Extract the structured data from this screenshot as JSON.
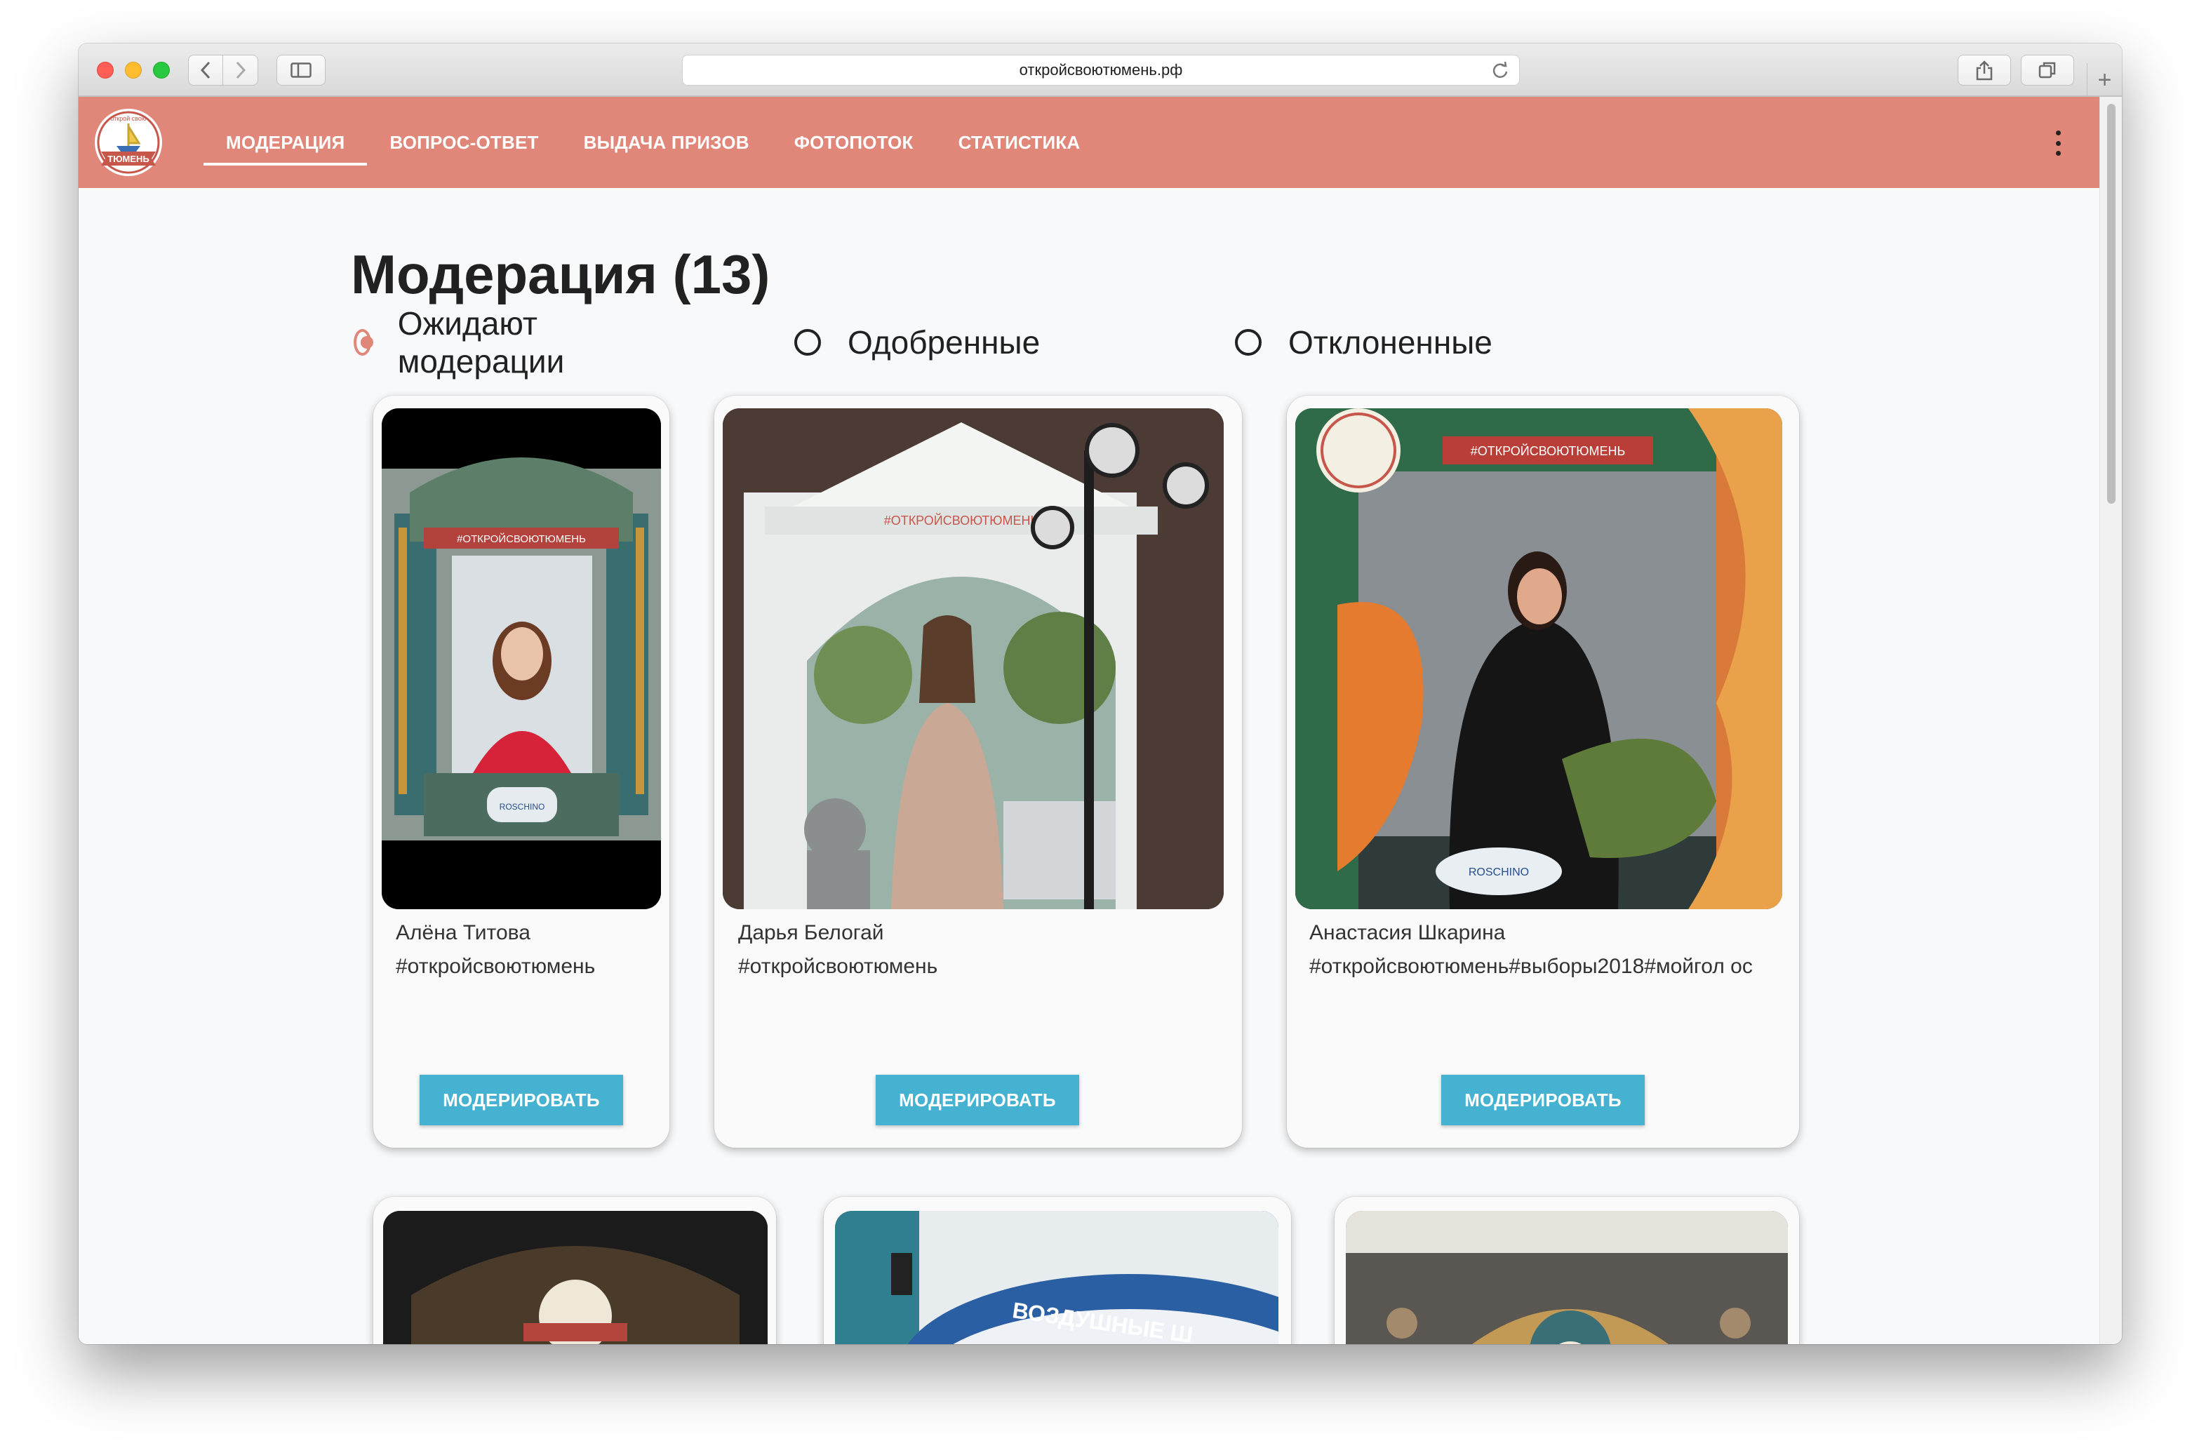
{
  "browser": {
    "url": "откройсвоютюмень.рф"
  },
  "app": {
    "logo_top_text": "открой свою",
    "logo_banner_text": "ТЮМЕНЬ",
    "accent_color": "#e0877a",
    "button_color": "#45b2d1",
    "menu": [
      {
        "label": "МОДЕРАЦИЯ",
        "active": true
      },
      {
        "label": "ВОПРОС-ОТВЕТ",
        "active": false
      },
      {
        "label": "ВЫДАЧА ПРИЗОВ",
        "active": false
      },
      {
        "label": "ФОТОПОТОК",
        "active": false
      },
      {
        "label": "СТАТИСТИКА",
        "active": false
      }
    ]
  },
  "page": {
    "title": "Модерация (13)",
    "filters": [
      {
        "label": "Ожидают модерации",
        "checked": true
      },
      {
        "label": "Одобренные",
        "checked": false
      },
      {
        "label": "Отклоненные",
        "checked": false
      }
    ]
  },
  "cards": [
    {
      "name": "Алёна Титова",
      "tag": "#откройсвоютюмень",
      "button": "МОДЕРИРОВАТЬ"
    },
    {
      "name": "Дарья Белогай",
      "tag": "#откройсвоютюмень",
      "button": "МОДЕРИРОВАТЬ"
    },
    {
      "name": "Анастасия Шкарина",
      "tag": "#откройсвоютюмень#выборы2018#мойгол ос",
      "button": "МОДЕРИРОВАТЬ"
    }
  ],
  "photo_text": {
    "frame_hashtag": "#ОТКРОЙСВОЮТЮМЕНЬ",
    "sponsor": "ROSCHINO",
    "sign": "ВОЗДУШНЫЕ Ш"
  }
}
